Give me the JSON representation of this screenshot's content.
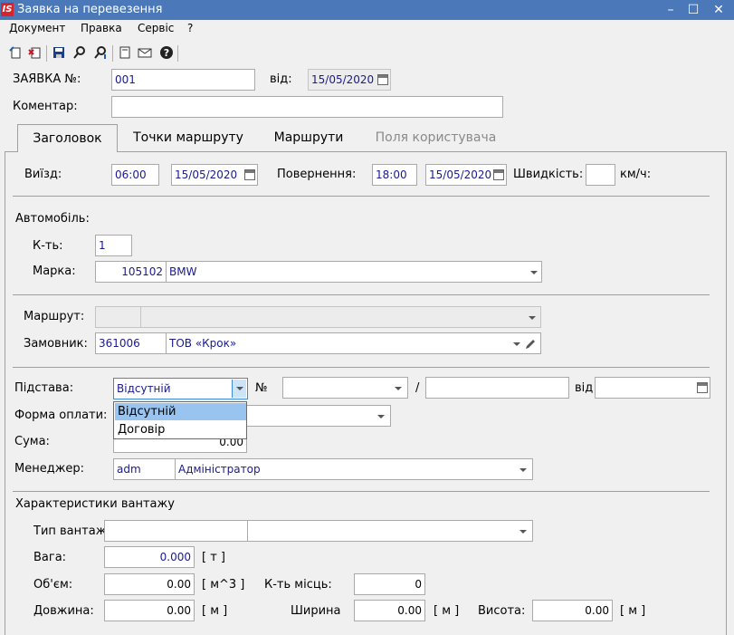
{
  "window": {
    "logo": "IS",
    "title": "Заявка на перевезення",
    "min": "–",
    "max": "☐",
    "close": "✕"
  },
  "menu": [
    "Документ",
    "Правка",
    "Сервіс",
    "?"
  ],
  "toolbar": {
    "icons": [
      "new-doc-icon",
      "delete-doc-icon",
      "save-icon",
      "search-icon",
      "find-next-icon",
      "page-icon",
      "mail-icon",
      "help-icon"
    ]
  },
  "header": {
    "number_label": "ЗАЯВКА №:",
    "number_value": "001",
    "from_label": "від:",
    "from_value": "15/05/2020",
    "comment_label": "Коментар:",
    "comment_value": ""
  },
  "tabs": [
    {
      "label": "Заголовок"
    },
    {
      "label": "Точки маршруту"
    },
    {
      "label": "Маршрути"
    },
    {
      "label": "Поля користувача"
    }
  ],
  "trip": {
    "departure_label": "Виїзд:",
    "departure_time": "06:00",
    "departure_date": "15/05/2020",
    "return_label": "Повернення:",
    "return_time": "18:00",
    "return_date": "15/05/2020",
    "speed_label": "Швидкість:",
    "speed_value": "",
    "speed_unit": "км/ч:"
  },
  "car": {
    "section_label": "Автомобіль:",
    "count_label": "К-ть:",
    "count_value": "1",
    "brand_label": "Марка:",
    "brand_code": "105102",
    "brand_name": "BMW"
  },
  "route": {
    "route_label": "Маршрут:",
    "route_code": "",
    "route_name": "",
    "customer_label": "Замовник:",
    "customer_code": "361006",
    "customer_name": "ТОВ «Крок»"
  },
  "basis": {
    "basis_label": "Підстава:",
    "basis_value": "Відсутній",
    "no_label": "№",
    "slash": "/",
    "from_label": "від",
    "dropdown_options": [
      "Відсутній",
      "Договір"
    ],
    "payment_label": "Форма оплати:",
    "sum_label": "Сума:",
    "sum_value": "0.00",
    "manager_label": "Менеджер:",
    "manager_code": "adm",
    "manager_name": "Адміністратор"
  },
  "cargo": {
    "section_label": "Характеристики вантажу",
    "type_label": "Тип вантажу",
    "weight_label": "Вага:",
    "weight_value": "0.000",
    "weight_unit": "[ т ]",
    "volume_label": "Об'єм:",
    "volume_value": "0.00",
    "volume_unit": "[ м^3 ]",
    "places_label": "К-ть місць:",
    "places_value": "0",
    "length_label": "Довжина:",
    "length_value": "0.00",
    "length_unit": "[ м ]",
    "width_label": "Ширина",
    "width_value": "0.00",
    "width_unit": "[ м ]",
    "height_label": "Висота:",
    "height_value": "0.00",
    "height_unit": "[ м ]"
  }
}
